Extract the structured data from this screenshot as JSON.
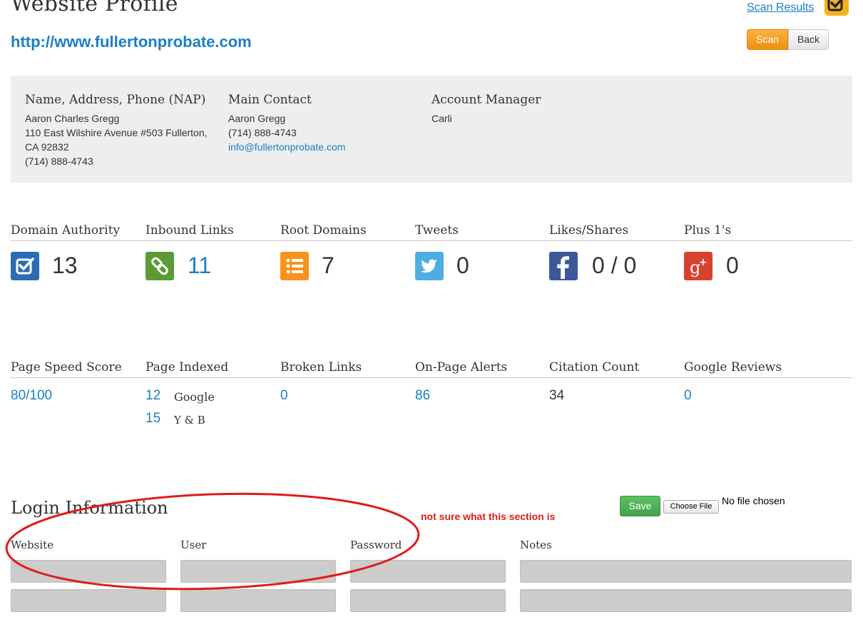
{
  "header": {
    "title": "Website Profile",
    "url": "http://www.fullertonprobate.com",
    "scan_results_link": "Scan Results",
    "scan_button": "Scan",
    "back_button": "Back"
  },
  "info": {
    "nap": {
      "heading": "Name, Address, Phone (NAP)",
      "lines": [
        "Aaron Charles Gregg",
        "110 East Wilshire Avenue #503 Fullerton,",
        "CA 92832",
        "(714) 888-4743"
      ]
    },
    "contact": {
      "heading": "Main Contact",
      "name": "Aaron Gregg",
      "phone": "(714) 888-4743",
      "email": "info@fullertonprobate.com"
    },
    "manager": {
      "heading": "Account Manager",
      "name": "Carli"
    }
  },
  "social_stats": [
    {
      "label": "Domain Authority",
      "value": "13",
      "icon": "checkbox-icon",
      "color": "#2a6db3"
    },
    {
      "label": "Inbound Links",
      "value": "11",
      "icon": "link-icon",
      "color": "#5b9a35"
    },
    {
      "label": "Root Domains",
      "value": "7",
      "icon": "list-icon",
      "color": "#f7921e"
    },
    {
      "label": "Tweets",
      "value": "0",
      "icon": "twitter-icon",
      "color": "#4eaee3"
    },
    {
      "label": "Likes/Shares",
      "value": "0 / 0",
      "icon": "facebook-icon",
      "color": "#3b5998"
    },
    {
      "label": "Plus 1's",
      "value": "0",
      "icon": "google-plus-icon",
      "color": "#d9412f"
    }
  ],
  "metrics": {
    "page_speed": {
      "label": "Page Speed Score",
      "value": "80/100"
    },
    "page_indexed": {
      "label": "Page Indexed",
      "google_value": "12",
      "google_label": "Google",
      "yb_value": "15",
      "yb_label": "Y & B"
    },
    "broken_links": {
      "label": "Broken Links",
      "value": "0"
    },
    "on_page_alerts": {
      "label": "On-Page Alerts",
      "value": "86"
    },
    "citation_count": {
      "label": "Citation Count",
      "value": "34"
    },
    "google_reviews": {
      "label": "Google Reviews",
      "value": "0"
    }
  },
  "login": {
    "title": "Login Information",
    "save_button": "Save",
    "choose_file": "Choose File",
    "no_file": "No file chosen",
    "annotation": "not sure what this section is",
    "columns": [
      "Website",
      "User",
      "Password",
      "Notes"
    ]
  }
}
